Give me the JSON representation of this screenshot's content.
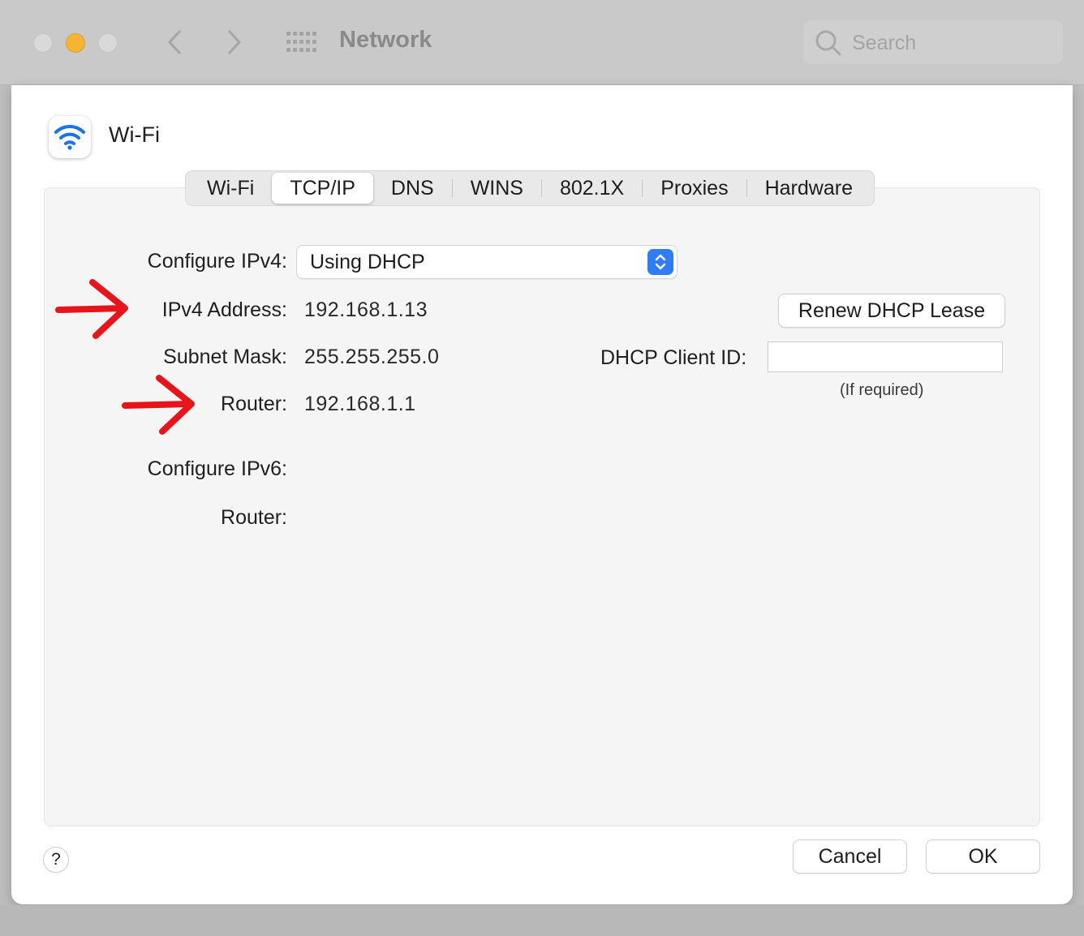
{
  "window": {
    "title": "Network",
    "search_placeholder": "Search",
    "accent_color": "#2f7cf6",
    "annotation_color": "#e8141b"
  },
  "sheet": {
    "title": "Wi-Fi",
    "tabs": [
      {
        "label": "Wi-Fi"
      },
      {
        "label": "TCP/IP",
        "active": true
      },
      {
        "label": "DNS"
      },
      {
        "label": "WINS"
      },
      {
        "label": "802.1X"
      },
      {
        "label": "Proxies"
      },
      {
        "label": "Hardware"
      }
    ]
  },
  "tcpip": {
    "configure_ipv4_label": "Configure IPv4:",
    "configure_ipv4_value": "Using DHCP",
    "ipv4_address_label": "IPv4 Address:",
    "ipv4_address_value": "192.168.1.13",
    "subnet_mask_label": "Subnet Mask:",
    "subnet_mask_value": "255.255.255.0",
    "router_label": "Router:",
    "router_value": "192.168.1.1",
    "configure_ipv6_label": "Configure IPv6:",
    "router6_label": "Router:",
    "renew_button": "Renew DHCP Lease",
    "dhcp_client_id_label": "DHCP Client ID:",
    "dhcp_client_id_value": "",
    "dhcp_client_id_hint": "(If required)"
  },
  "footer": {
    "help_label": "?",
    "cancel_label": "Cancel",
    "ok_label": "OK"
  }
}
